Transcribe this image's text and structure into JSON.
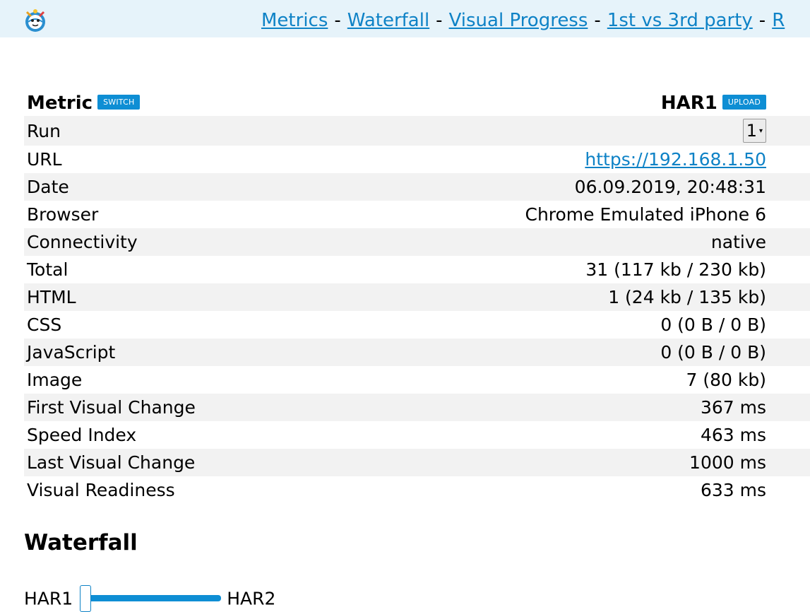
{
  "nav": {
    "items": [
      "Metrics",
      "Waterfall",
      "Visual Progress",
      "1st vs 3rd party",
      "R"
    ],
    "separator": "-"
  },
  "table": {
    "metric_header": "Metric",
    "switch_label": "SWITCH",
    "har_header": "HAR1",
    "upload_label": "UPLOAD",
    "run_label": "Run",
    "run_value": "1",
    "url_label": "URL",
    "url_value": "https://192.168.1.50",
    "rows": [
      {
        "label": "Date",
        "value": "06.09.2019, 20:48:31"
      },
      {
        "label": "Browser",
        "value": "Chrome Emulated iPhone 6"
      },
      {
        "label": "Connectivity",
        "value": "native"
      },
      {
        "label": "Total",
        "value": "31 (117 kb / 230 kb)"
      },
      {
        "label": "HTML",
        "value": "1 (24 kb / 135 kb)"
      },
      {
        "label": "CSS",
        "value": "0 (0 B / 0 B)"
      },
      {
        "label": "JavaScript",
        "value": "0 (0 B / 0 B)"
      },
      {
        "label": "Image",
        "value": "7 (80 kb)"
      },
      {
        "label": "First Visual Change",
        "value": "367 ms"
      },
      {
        "label": "Speed Index",
        "value": "463 ms"
      },
      {
        "label": "Last Visual Change",
        "value": "1000 ms"
      },
      {
        "label": "Visual Readiness",
        "value": "633 ms"
      }
    ]
  },
  "waterfall": {
    "heading": "Waterfall",
    "left_label": "HAR1",
    "right_label": "HAR2",
    "slider_fraction": 0
  },
  "colors": {
    "accent": "#0e8ed4",
    "link": "#0e82c6",
    "topbar_bg": "#e6f3fa",
    "row_shade": "#f2f2f2"
  },
  "icons": {
    "logo": "sitespeed-logo-icon",
    "select_caret": "caret-down-icon"
  }
}
